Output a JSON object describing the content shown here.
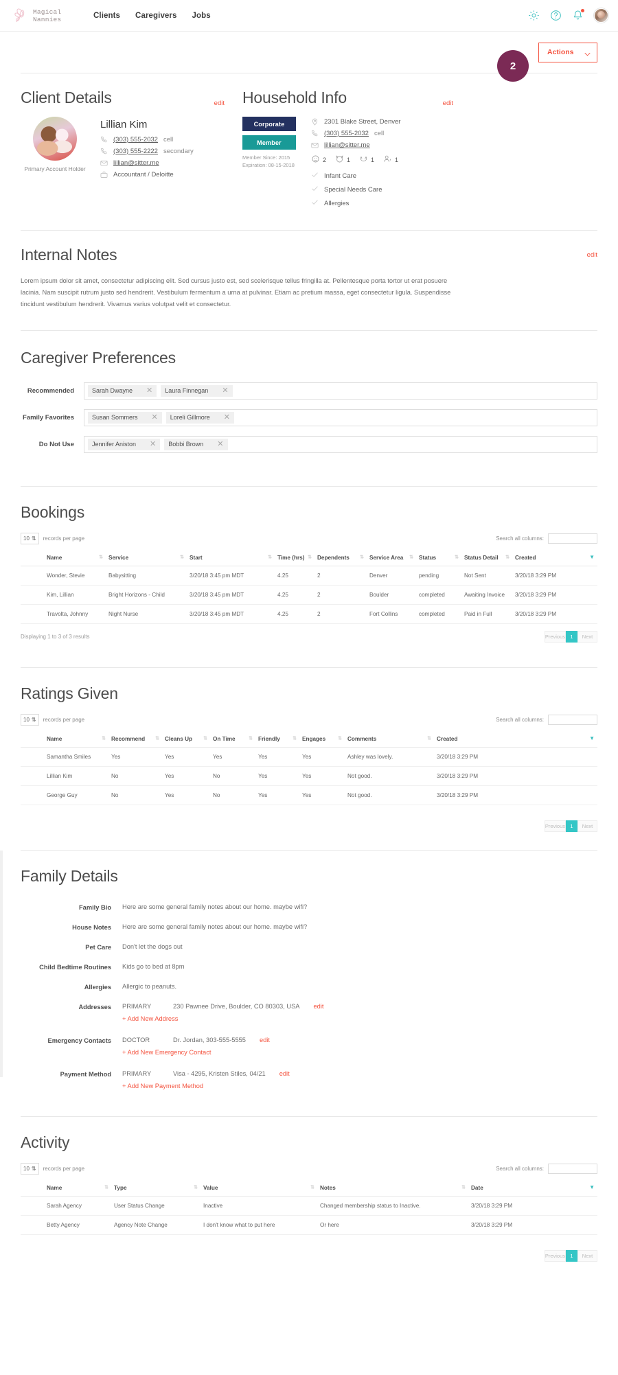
{
  "nav": {
    "brand": "Magical Nannies",
    "links": [
      "Clients",
      "Caregivers",
      "Jobs"
    ],
    "icons": [
      "gear-icon",
      "help-icon",
      "bell-icon",
      "user-avatar"
    ]
  },
  "actions": {
    "label": "Actions",
    "badge": "2"
  },
  "client": {
    "title": "Client Details",
    "edit": "edit",
    "photo_caption": "Primary Account Holder",
    "name": "Lillian Kim",
    "phone_primary": "(303) 555-2032",
    "phone_primary_type": "cell",
    "phone_secondary": "(303) 555-2222",
    "phone_secondary_type": "secondary",
    "email": "lillian@sitter.me",
    "occupation": "Accountant / Deloitte"
  },
  "household": {
    "title": "Household Info",
    "edit": "edit",
    "badge_corporate": "Corporate",
    "badge_member": "Member",
    "member_since": "Member Since: 2015",
    "expiration": "Expiration: 08-15-2018",
    "address": "2301 Blake Street, Denver",
    "phone": "(303) 555-2032",
    "phone_type": "cell",
    "email": "lillian@sitter.me",
    "counts": [
      {
        "icon": "child-icon",
        "value": "2"
      },
      {
        "icon": "cat-icon",
        "value": "1"
      },
      {
        "icon": "dog-icon",
        "value": "1"
      },
      {
        "icon": "senior-icon",
        "value": "1"
      }
    ],
    "care_items": [
      "Infant Care",
      "Special Needs Care",
      "Allergies"
    ]
  },
  "internal_notes": {
    "title": "Internal Notes",
    "edit": "edit",
    "body": "Lorem ipsum dolor sit amet, consectetur adipiscing elit. Sed cursus justo est, sed scelerisque tellus fringilla at. Pellentesque porta tortor ut erat posuere lacinia. Nam suscipit rutrum justo sed hendrerit. Vestibulum fermentum a urna at pulvinar. Etiam ac pretium massa, eget consectetur ligula. Suspendisse tincidunt vestibulum hendrerit. Vivamus varius volutpat velit et consectetur."
  },
  "caregiver_preferences": {
    "title": "Caregiver Preferences",
    "rows": [
      {
        "label": "Recommended",
        "chips": [
          "Sarah Dwayne",
          "Laura Finnegan"
        ]
      },
      {
        "label": "Family Favorites",
        "chips": [
          "Susan Sommers",
          "Loreli Gillmore"
        ]
      },
      {
        "label": "Do Not Use",
        "chips": [
          "Jennifer Aniston",
          "Bobbi Brown"
        ]
      }
    ]
  },
  "bookings": {
    "title": "Bookings",
    "records_per_page": "10",
    "records_per_page_label": "records per page",
    "search_label": "Search all columns:",
    "search_value": "",
    "columns": [
      "Name",
      "Service",
      "Start",
      "Time (hrs)",
      "Dependents",
      "Service Area",
      "Status",
      "Status Detail",
      "Created"
    ],
    "rows": [
      {
        "avatar": "",
        "name": "Wonder, Stevie",
        "service": "Babysitting",
        "start": "3/20/18 3:45 pm MDT",
        "time": "4.25",
        "dependents": "2",
        "area": "Denver",
        "status": "pending",
        "detail": "Not Sent",
        "created": "3/20/18 3:29 PM"
      },
      {
        "avatar": "a",
        "name": "Kim, Lillian",
        "service": "Bright Horizons - Child",
        "start": "3/20/18 3:45 pm MDT",
        "time": "4.25",
        "dependents": "2",
        "area": "Boulder",
        "status": "completed",
        "detail": "Awaiting Invoice",
        "created": "3/20/18 3:29 PM"
      },
      {
        "avatar": "b",
        "name": "Travolta, Johnny",
        "service": "Night Nurse",
        "start": "3/20/18 3:45 pm MDT",
        "time": "4.25",
        "dependents": "2",
        "area": "Fort Collins",
        "status": "completed",
        "detail": "Paid in Full",
        "created": "3/20/18 3:29 PM"
      }
    ],
    "footer": "Displaying 1 to 3 of 3 results",
    "pager": {
      "previous": "Previous",
      "page": "1",
      "next": "Next"
    }
  },
  "ratings": {
    "title": "Ratings Given",
    "records_per_page": "10",
    "records_per_page_label": "records per page",
    "search_label": "Search all columns:",
    "search_value": "",
    "columns": [
      "Name",
      "Recommend",
      "Cleans Up",
      "On Time",
      "Friendly",
      "Engages",
      "Comments",
      "Created"
    ],
    "rows": [
      {
        "avatar": "c",
        "name": "Samantha Smiles",
        "recommend": "Yes",
        "cleans": "Yes",
        "ontime": "Yes",
        "friendly": "Yes",
        "engages": "Yes",
        "comments": "Ashley was lovely.",
        "created": "3/20/18 3:29 PM"
      },
      {
        "avatar": "a",
        "name": "Lillian Kim",
        "recommend": "No",
        "cleans": "Yes",
        "ontime": "No",
        "friendly": "Yes",
        "engages": "Yes",
        "comments": "Not good.",
        "created": "3/20/18 3:29 PM"
      },
      {
        "avatar": "b",
        "name": "George Guy",
        "recommend": "No",
        "cleans": "Yes",
        "ontime": "No",
        "friendly": "Yes",
        "engages": "Yes",
        "comments": "Not good.",
        "created": "3/20/18 3:29 PM"
      }
    ],
    "pager": {
      "previous": "Previous",
      "page": "1",
      "next": "Next"
    }
  },
  "family_details": {
    "title": "Family Details",
    "family_bio_label": "Family Bio",
    "family_bio": "Here are some general family notes about our home. maybe wifi?",
    "house_notes_label": "House Notes",
    "house_notes": "Here are some general family notes about our home. maybe wifi?",
    "pet_care_label": "Pet Care",
    "pet_care": "Don't let the dogs out",
    "bedtime_label": "Child Bedtime Routines",
    "bedtime": "Kids go to bed at 8pm",
    "allergies_label": "Allergies",
    "allergies": "Allergic to peanuts.",
    "addresses_label": "Addresses",
    "address_kind": "PRIMARY",
    "address_value": "230 Pawnee Drive, Boulder, CO 80303, USA",
    "address_edit": "edit",
    "address_add": "+ Add New Address",
    "emergency_label": "Emergency Contacts",
    "emergency_kind": "DOCTOR",
    "emergency_value": "Dr. Jordan, 303-555-5555",
    "emergency_edit": "edit",
    "emergency_add": "+ Add New Emergency Contact",
    "payment_label": "Payment Method",
    "payment_kind": "PRIMARY",
    "payment_value": "Visa - 4295, Kristen Stiles, 04/21",
    "payment_edit": "edit",
    "payment_add": "+ Add New Payment Method"
  },
  "activity": {
    "title": "Activity",
    "records_per_page": "10",
    "records_per_page_label": "records per page",
    "search_label": "Search all columns:",
    "search_value": "",
    "columns": [
      "Name",
      "Type",
      "Value",
      "Notes",
      "Date"
    ],
    "rows": [
      {
        "avatar": "",
        "name": "Sarah Agency",
        "type": "User Status Change",
        "value": "Inactive",
        "notes": "Changed membership status to Inactive.",
        "date": "3/20/18 3:29 PM"
      },
      {
        "avatar": "a",
        "name": "Betty Agency",
        "type": "Agency Note Change",
        "value": "I don't know what to put here",
        "notes": "Or here",
        "date": "3/20/18 3:29 PM"
      }
    ],
    "pager": {
      "previous": "Previous",
      "page": "1",
      "next": "Next"
    }
  },
  "colors": {
    "accent": "#f4533f",
    "teal": "#34c6c6",
    "navy": "#233160",
    "member": "#199a97",
    "badge": "#7b2a55"
  }
}
